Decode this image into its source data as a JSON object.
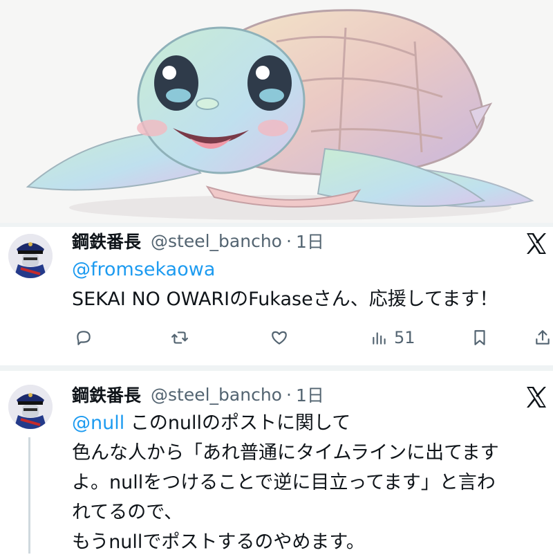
{
  "hero_image": {
    "description_icon": "turtle-illustration"
  },
  "tweets": [
    {
      "author_name": "鋼鉄番長",
      "handle": "@steel_bancho",
      "separator": "·",
      "time": "1日",
      "mention": "@fromsekaowa",
      "text": "SEKAI NO OWARIのFukaseさん、応援してます！",
      "actions": {
        "reply_icon": "reply-icon",
        "retweet_icon": "retweet-icon",
        "like_icon": "heart-icon",
        "views_icon": "views-icon",
        "views_count": "51",
        "bookmark_icon": "bookmark-icon",
        "share_icon": "share-icon"
      }
    },
    {
      "author_name": "鋼鉄番長",
      "handle": "@steel_bancho",
      "separator": "·",
      "time": "1日",
      "mention": "@null",
      "line1": " このnullのポストに関して",
      "line2": "色んな人から「あれ普通にタイムラインに出てます",
      "line3": "よ。nullをつけることで逆に目立ってます」と言わ",
      "line4": "れてるので、",
      "line5": "もうnullでポストするのやめます。"
    }
  ],
  "colors": {
    "link": "#1d9bf0",
    "secondary": "#536471",
    "text": "#0f1419"
  }
}
